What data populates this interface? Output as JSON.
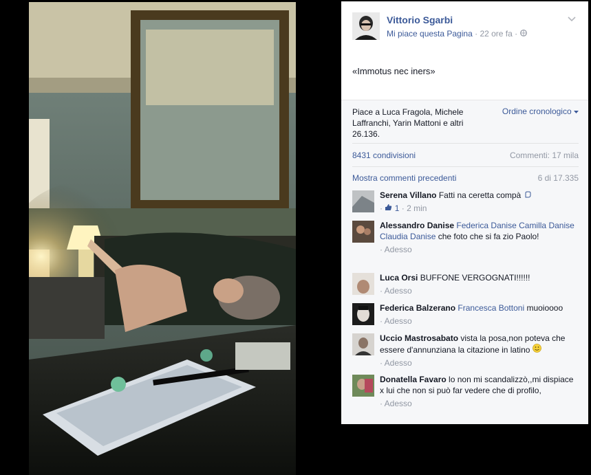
{
  "post": {
    "author": "Vittorio Sgarbi",
    "like_page": "Mi piace questa Pagina",
    "dot": "·",
    "time": "22 ore fa",
    "dot2": "·",
    "text": "«Immotus nec iners»"
  },
  "feedback": {
    "likes_text": "Piace a Luca Fragola, Michele Laffranchi, Yarin Mattoni e altri 26.136.",
    "order_label": "Ordine cronologico",
    "shares": "8431 condivisioni",
    "comments_total": "Commenti: 17 mila",
    "previous_comments": "Mostra commenti precedenti",
    "pager": "6 di 17.335"
  },
  "comments": [
    {
      "name": "Serena Villano",
      "text": "Fatti na ceretta compà",
      "like_count": "1",
      "time": "2 min"
    },
    {
      "name": "Alessandro Danise",
      "tags": "Federica Danise Camilla Danise Claudia Danise",
      "text": "che foto che si fa zio Paolo!",
      "time": "Adesso"
    },
    {
      "name": "Luca Orsi",
      "text": "BUFFONE VERGOGNATI!!!!!!",
      "time": "Adesso"
    },
    {
      "name": "Federica Balzerano",
      "tags": "Francesca Bottoni",
      "text": "muoioooo",
      "time": "Adesso"
    },
    {
      "name": "Uccio Mastrosabato",
      "text": "vista la posa,non poteva che essere d'annunziana la citazione in latino",
      "time": "Adesso"
    },
    {
      "name": "Donatella Favaro",
      "text": "lo non mi scandalizzò,,mi dispiace x lui che non si può far vedere che di profilo,",
      "time": "Adesso"
    }
  ],
  "icons": {
    "chevron": "chevron-down-icon",
    "globe": "globe-icon",
    "thumb": "thumbs-up-icon",
    "smile": "smile-emoji-icon"
  },
  "colors": {
    "link": "#3b5998",
    "muted": "#9197a3",
    "panel": "#f6f7f9"
  }
}
